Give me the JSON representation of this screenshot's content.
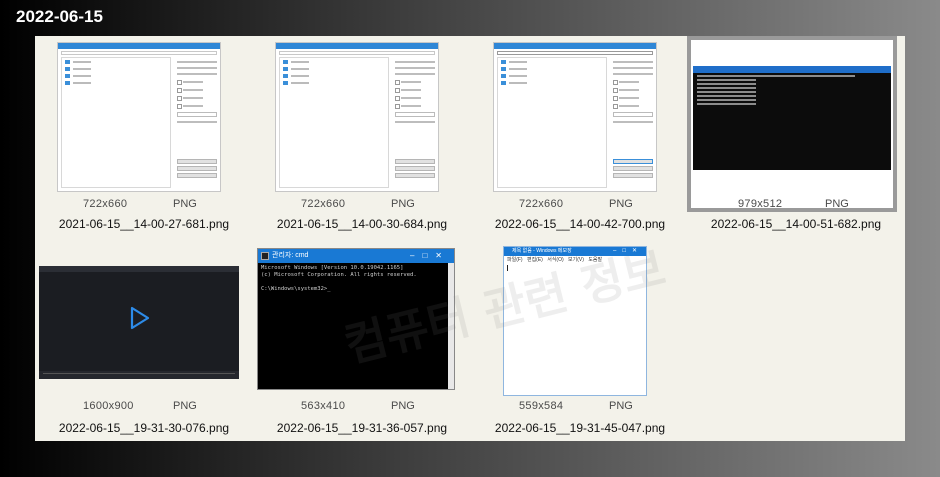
{
  "group": {
    "date": "2022-06-15"
  },
  "watermark": "컴퓨터 관련 정보",
  "tiles": [
    {
      "dimensions": "722x660",
      "format": "PNG",
      "filename": "2021-06-15__14-00-27-681.png"
    },
    {
      "dimensions": "722x660",
      "format": "PNG",
      "filename": "2021-06-15__14-00-30-684.png"
    },
    {
      "dimensions": "722x660",
      "format": "PNG",
      "filename": "2022-06-15__14-00-42-700.png"
    },
    {
      "dimensions": "979x512",
      "format": "PNG",
      "filename": "2022-06-15__14-00-51-682.png"
    },
    {
      "dimensions": "1600x900",
      "format": "PNG",
      "filename": "2022-06-15__19-31-30-076.png"
    },
    {
      "dimensions": "563x410",
      "format": "PNG",
      "filename": "2022-06-15__19-31-36-057.png"
    },
    {
      "dimensions": "559x584",
      "format": "PNG",
      "filename": "2022-06-15__19-31-45-047.png"
    }
  ],
  "thumbs": {
    "explorer_tree": [
      "Desktop",
      "data",
      "C:",
      "D:"
    ],
    "cmd": {
      "title": "관리자: cmd",
      "lines": [
        "Microsoft Windows [Version 10.0.19042.1165]",
        "(c) Microsoft Corporation. All rights reserved.",
        "",
        "C:\\Windows\\system32>_"
      ]
    },
    "notepad": {
      "title": "제목 없음 - Windows 메모장",
      "menu": "파일(F) 편집(E) 서식(O) 보기(V) 도움말"
    }
  }
}
